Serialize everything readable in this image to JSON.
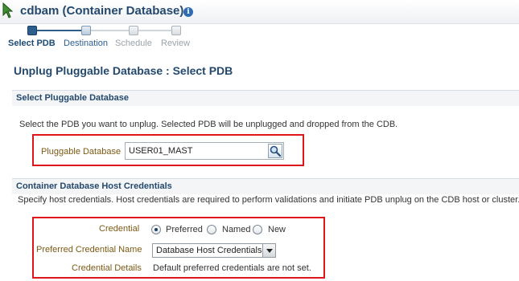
{
  "header": {
    "title": "cdbam (Container Database)",
    "title_icon": "info-icon",
    "cursor_icon": "mouse-pointer-icon"
  },
  "train": {
    "steps": [
      {
        "label": "Select PDB",
        "state": "active"
      },
      {
        "label": "Destination",
        "state": "next"
      },
      {
        "label": "Schedule",
        "state": "disabled"
      },
      {
        "label": "Review",
        "state": "disabled"
      }
    ]
  },
  "page": {
    "title": "Unplug Pluggable Database : Select PDB"
  },
  "select_pdb": {
    "heading": "Select Pluggable Database",
    "instructions": "Select the PDB you want to unplug. Selected PDB will be unplugged and dropped from the CDB.",
    "field_label": "Pluggable Database",
    "field_value": "USER01_MAST",
    "search_icon": "magnifier-icon"
  },
  "credentials": {
    "heading": "Container Database Host Credentials",
    "instructions": "Specify host credentials. Host credentials are required to perform validations and initiate PDB unplug on the CDB host or cluster.",
    "credential_label": "Credential",
    "options": [
      "Preferred",
      "Named",
      "New"
    ],
    "selected_option": "Preferred",
    "preferred_name_label": "Preferred Credential Name",
    "preferred_name_value": "Database Host Credentials",
    "details_label": "Credential Details",
    "details_value": "Default preferred credentials are not set."
  },
  "colors": {
    "title": "#24496d",
    "field_label": "#7c5a14",
    "highlight_box": "#e0141b",
    "train_active": "#2c5e8e"
  }
}
